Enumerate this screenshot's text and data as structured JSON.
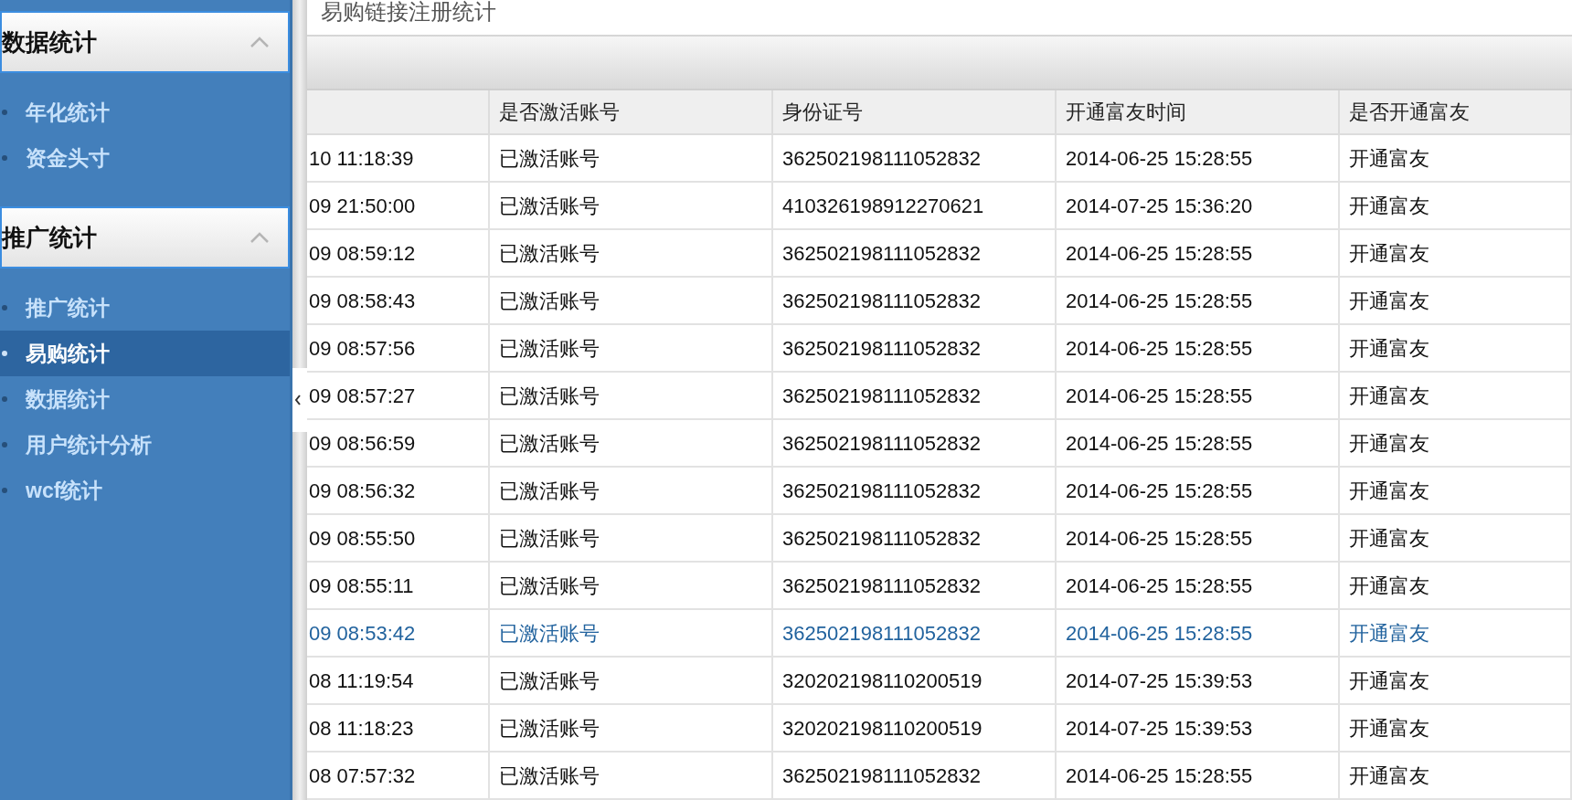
{
  "sidebar": {
    "groups": [
      {
        "title": "数据统计",
        "expanded": true,
        "items": [
          {
            "label": "年化统计",
            "selected": false
          },
          {
            "label": "资金头寸",
            "selected": false
          }
        ]
      },
      {
        "title": "推广统计",
        "expanded": true,
        "items": [
          {
            "label": "推广统计",
            "selected": false
          },
          {
            "label": "易购统计",
            "selected": true
          },
          {
            "label": "数据统计",
            "selected": false
          },
          {
            "label": "用户统计分析",
            "selected": false
          },
          {
            "label": "wcf统计",
            "selected": false
          }
        ]
      }
    ]
  },
  "page_title": "易购链接注册统计",
  "table": {
    "columns": [
      "",
      "是否激活账号",
      "身份证号",
      "开通富友时间",
      "是否开通富友"
    ],
    "rows": [
      {
        "selected": false,
        "cells": [
          "10 11:18:39",
          "已激活账号",
          "362502198111052832",
          "2014-06-25 15:28:55",
          "开通富友"
        ]
      },
      {
        "selected": false,
        "cells": [
          "09 21:50:00",
          "已激活账号",
          "410326198912270621",
          "2014-07-25 15:36:20",
          "开通富友"
        ]
      },
      {
        "selected": false,
        "cells": [
          "09 08:59:12",
          "已激活账号",
          "362502198111052832",
          "2014-06-25 15:28:55",
          "开通富友"
        ]
      },
      {
        "selected": false,
        "cells": [
          "09 08:58:43",
          "已激活账号",
          "362502198111052832",
          "2014-06-25 15:28:55",
          "开通富友"
        ]
      },
      {
        "selected": false,
        "cells": [
          "09 08:57:56",
          "已激活账号",
          "362502198111052832",
          "2014-06-25 15:28:55",
          "开通富友"
        ]
      },
      {
        "selected": false,
        "cells": [
          "09 08:57:27",
          "已激活账号",
          "362502198111052832",
          "2014-06-25 15:28:55",
          "开通富友"
        ]
      },
      {
        "selected": false,
        "cells": [
          "09 08:56:59",
          "已激活账号",
          "362502198111052832",
          "2014-06-25 15:28:55",
          "开通富友"
        ]
      },
      {
        "selected": false,
        "cells": [
          "09 08:56:32",
          "已激活账号",
          "362502198111052832",
          "2014-06-25 15:28:55",
          "开通富友"
        ]
      },
      {
        "selected": false,
        "cells": [
          "09 08:55:50",
          "已激活账号",
          "362502198111052832",
          "2014-06-25 15:28:55",
          "开通富友"
        ]
      },
      {
        "selected": false,
        "cells": [
          "09 08:55:11",
          "已激活账号",
          "362502198111052832",
          "2014-06-25 15:28:55",
          "开通富友"
        ]
      },
      {
        "selected": true,
        "cells": [
          "09 08:53:42",
          "已激活账号",
          "362502198111052832",
          "2014-06-25 15:28:55",
          "开通富友"
        ]
      },
      {
        "selected": false,
        "cells": [
          "08 11:19:54",
          "已激活账号",
          "320202198110200519",
          "2014-07-25 15:39:53",
          "开通富友"
        ]
      },
      {
        "selected": false,
        "cells": [
          "08 11:18:23",
          "已激活账号",
          "320202198110200519",
          "2014-07-25 15:39:53",
          "开通富友"
        ]
      },
      {
        "selected": false,
        "cells": [
          "08 07:57:32",
          "已激活账号",
          "362502198111052832",
          "2014-06-25 15:28:55",
          "开通富友"
        ]
      }
    ]
  }
}
